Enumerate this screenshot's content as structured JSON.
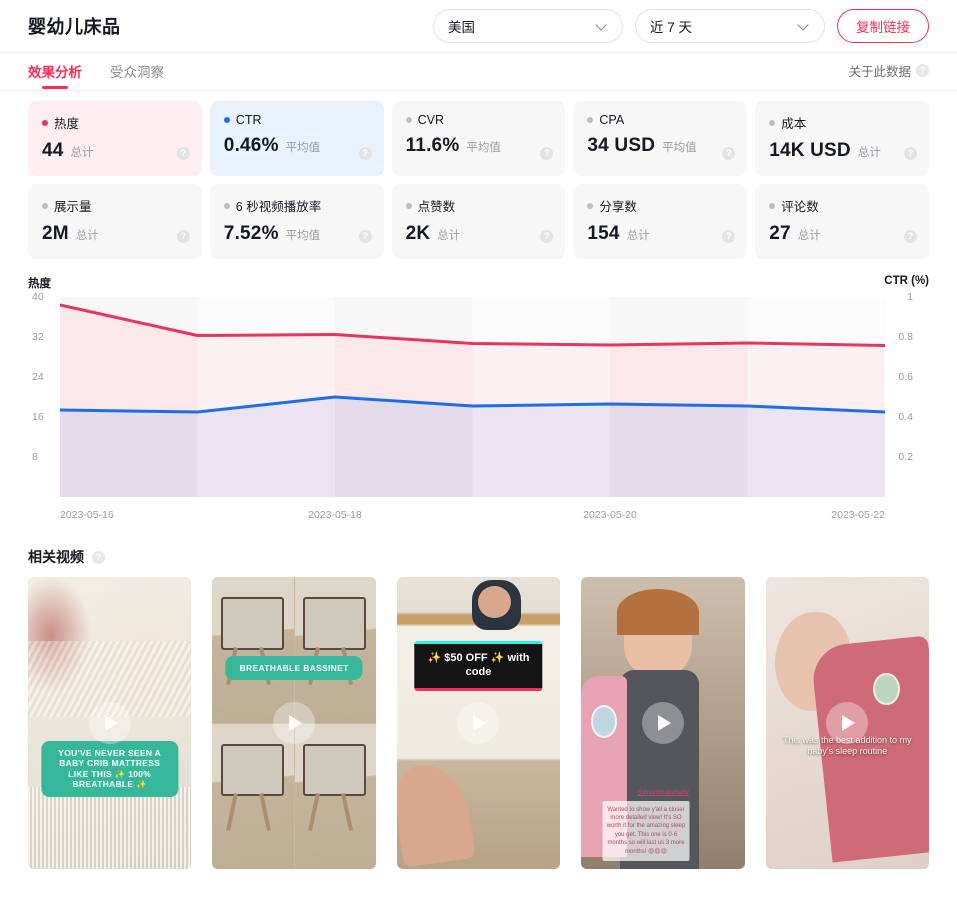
{
  "header": {
    "title": "婴幼儿床品",
    "region_select": {
      "value": "美国"
    },
    "date_select": {
      "value": "近 7 天"
    },
    "copy_link_label": "复制链接"
  },
  "tabs": [
    {
      "label": "效果分析",
      "active": true
    },
    {
      "label": "受众洞察",
      "active": false
    }
  ],
  "about_data_label": "关于此数据",
  "help_glyph": "?",
  "colors": {
    "accent": "#fe2c55",
    "heat_line": "#e8355a",
    "ctr_line": "#1d6ee8",
    "heat_card_bg": "#fdeef1",
    "ctr_card_bg": "#e8f1fc"
  },
  "metrics": [
    {
      "name": "热度",
      "value": "44",
      "unit": "总计",
      "dot": "red",
      "selected": "red"
    },
    {
      "name": "CTR",
      "value": "0.46%",
      "unit": "平均值",
      "dot": "blue",
      "selected": "blue"
    },
    {
      "name": "CVR",
      "value": "11.6%",
      "unit": "平均值",
      "dot": "grey",
      "selected": "none"
    },
    {
      "name": "CPA",
      "value": "34 USD",
      "unit": "平均值",
      "dot": "grey",
      "selected": "none"
    },
    {
      "name": "成本",
      "value": "14K USD",
      "unit": "总计",
      "dot": "grey",
      "selected": "none"
    },
    {
      "name": "展示量",
      "value": "2M",
      "unit": "总计",
      "dot": "grey",
      "selected": "none"
    },
    {
      "name": "6 秒视频播放率",
      "value": "7.52%",
      "unit": "平均值",
      "dot": "grey",
      "selected": "none"
    },
    {
      "name": "点赞数",
      "value": "2K",
      "unit": "总计",
      "dot": "grey",
      "selected": "none"
    },
    {
      "name": "分享数",
      "value": "154",
      "unit": "总计",
      "dot": "grey",
      "selected": "none"
    },
    {
      "name": "评论数",
      "value": "27",
      "unit": "总计",
      "dot": "grey",
      "selected": "none"
    }
  ],
  "chart_data": {
    "type": "line",
    "title": "",
    "left_axis_title": "热度",
    "right_axis_title": "CTR (%)",
    "xlabel": "",
    "x": [
      "2023-05-16",
      "2023-05-17",
      "2023-05-18",
      "2023-05-19",
      "2023-05-20",
      "2023-05-21",
      "2023-05-22"
    ],
    "xtick_labels": [
      "2023-05-16",
      "2023-05-18",
      "2023-05-20",
      "2023-05-22"
    ],
    "left_ticks": [
      8,
      16,
      24,
      32,
      40
    ],
    "right_ticks": [
      0.2,
      0.4,
      0.6,
      0.8,
      1
    ],
    "ylim_left": [
      0,
      40
    ],
    "ylim_right": [
      0,
      1
    ],
    "grid": false,
    "legend": "none",
    "series": [
      {
        "name": "热度",
        "axis": "left",
        "color": "#e8355a",
        "fill": "#fbe4e9",
        "values": [
          38.4,
          32.3,
          32.5,
          30.7,
          30.4,
          30.8,
          30.3
        ]
      },
      {
        "name": "CTR",
        "axis": "right",
        "color": "#1d6ee8",
        "fill": "#dcd8ec",
        "values": [
          0.435,
          0.425,
          0.5,
          0.455,
          0.465,
          0.455,
          0.425
        ]
      }
    ]
  },
  "related_videos": {
    "title": "相关视频",
    "items": [
      {
        "id": "video-1",
        "caption_style": "teal",
        "caption": "YOU'VE NEVER SEEN A BABY CRIB MATTRESS LIKE THIS ✨ 100% BREATHABLE ✨"
      },
      {
        "id": "video-2",
        "caption_style": "teal",
        "caption": "BREATHABLE BASSINET"
      },
      {
        "id": "video-3",
        "caption_style": "black",
        "caption": "✨ $50 OFF ✨ with code"
      },
      {
        "id": "video-4",
        "caption_style": "pinkbox",
        "handle": "@dreambabybaby",
        "caption": "Wanted to show y'all a closer more detailed view! It's SO worth it for the amazing sleep you get. This one is 0-6 months so will last us 3 more months! 😍😍😍"
      },
      {
        "id": "video-5",
        "caption_style": "plain",
        "caption": "This was the best addition to my baby's sleep routine"
      }
    ]
  }
}
